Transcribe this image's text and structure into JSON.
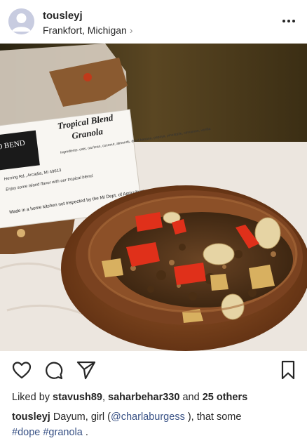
{
  "post": {
    "username": "tousleyj",
    "location": "Frankfort, Michigan",
    "location_chevron": "›"
  },
  "image": {
    "label": {
      "brand_partial": "MO BEND",
      "product_line1": "Tropical Blend",
      "product_line2": "Granola",
      "ingredients": "Ingredients: oats, oat bran, coconut, almonds, dried banana, papaya, pineapple, cinnamon, vanilla",
      "address": "Herring Rd., Arcadia, MI 49613",
      "tagline": "Enjoy some island flavor with our tropical blend.",
      "notice": "Made in a home kitchen not inspected by the MI Dept. of Agriculture"
    }
  },
  "actions": {
    "like_icon": "heart-icon",
    "comment_icon": "comment-icon",
    "share_icon": "send-icon",
    "save_icon": "bookmark-icon"
  },
  "likes": {
    "prefix": "Liked by",
    "user1": "stavush89",
    "separator": ",",
    "user2": "saharbehar330",
    "and": "and",
    "others": "25 others"
  },
  "caption": {
    "username": "tousleyj",
    "text1": "Dayum, girl (",
    "mention": "@charlaburgess",
    "text2": " ), that some",
    "hashtag1": "#dope",
    "hashtag2": "#granola",
    "end": " ."
  },
  "colors": {
    "text": "#262626",
    "link": "#385185",
    "secondary": "#8e8e8e"
  }
}
